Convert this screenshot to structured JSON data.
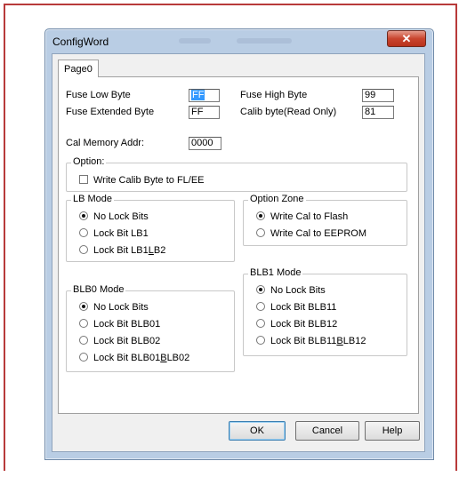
{
  "window": {
    "title": "ConfigWord",
    "close_icon": "close-icon"
  },
  "tabs": [
    "Page0"
  ],
  "fuses": {
    "low_label": "Fuse Low Byte",
    "low_value": "FF",
    "extended_label": "Fuse Extended Byte",
    "extended_value": "FF",
    "high_label": "Fuse High Byte",
    "high_value": "99",
    "calib_label": "Calib byte(Read Only)",
    "calib_value": "81",
    "cal_memory_label": "Cal Memory Addr:",
    "cal_memory_value": "0000"
  },
  "option_group": {
    "title": "Option:",
    "write_calib_label": "Write Calib Byte to FL/EE",
    "write_calib_checked": false
  },
  "lb_mode": {
    "title": "LB Mode",
    "options": [
      {
        "label": "No Lock Bits",
        "selected": true
      },
      {
        "label": "Lock Bit LB1",
        "selected": false
      },
      {
        "label_pre": "Lock Bit LB1",
        "label_u": "L",
        "label_post": "B2",
        "selected": false
      }
    ]
  },
  "option_zone": {
    "title": "Option Zone",
    "options": [
      {
        "label": "Write Cal to Flash",
        "selected": true
      },
      {
        "label": "Write Cal to EEPROM",
        "selected": false
      }
    ]
  },
  "blb0_mode": {
    "title": "BLB0 Mode",
    "options": [
      {
        "label": "No Lock Bits",
        "selected": true
      },
      {
        "label": "Lock Bit BLB01",
        "selected": false
      },
      {
        "label": "Lock Bit BLB02",
        "selected": false
      },
      {
        "label_pre": "Lock Bit BLB01",
        "label_u": "B",
        "label_post": "LB02",
        "selected": false
      }
    ]
  },
  "blb1_mode": {
    "title": "BLB1 Mode",
    "options": [
      {
        "label": "No Lock Bits",
        "selected": true
      },
      {
        "label": "Lock Bit BLB11",
        "selected": false
      },
      {
        "label": "Lock Bit BLB12",
        "selected": false
      },
      {
        "label_pre": "Lock Bit BLB11",
        "label_u": "B",
        "label_post": "LB12",
        "selected": false
      }
    ]
  },
  "buttons": {
    "ok": "OK",
    "cancel": "Cancel",
    "help": "Help"
  },
  "colors": {
    "frame_border": "#b83a3a",
    "title_bar": "#b9cde4",
    "close_button": "#c9452e",
    "selection": "#3399ff"
  }
}
